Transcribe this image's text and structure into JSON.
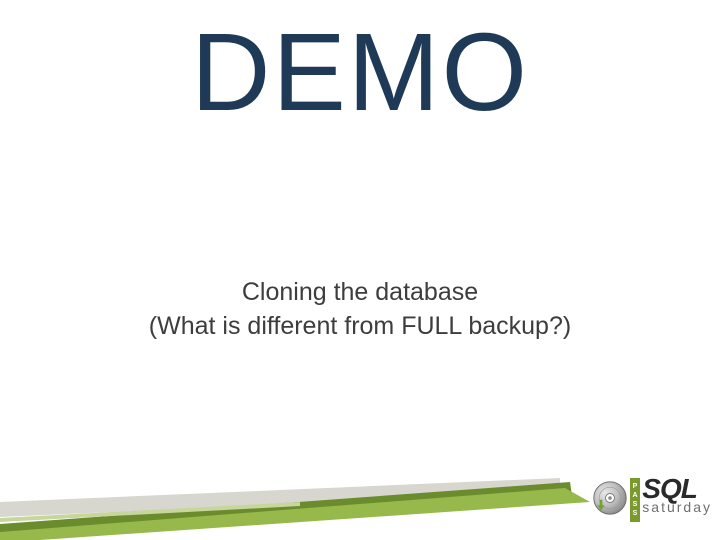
{
  "title": "DEMO",
  "subtitle_line1": "Cloning the database",
  "subtitle_line2": "(What is different from FULL backup?)",
  "logo": {
    "sql": "SQL",
    "saturday": "saturday",
    "pass_letters": [
      "P",
      "A",
      "S",
      "S"
    ]
  },
  "colors": {
    "title": "#1f3a57",
    "accent_green_dark": "#698c2a",
    "accent_green_light": "#9fbf4d",
    "accent_gray": "#d7d7cf"
  }
}
